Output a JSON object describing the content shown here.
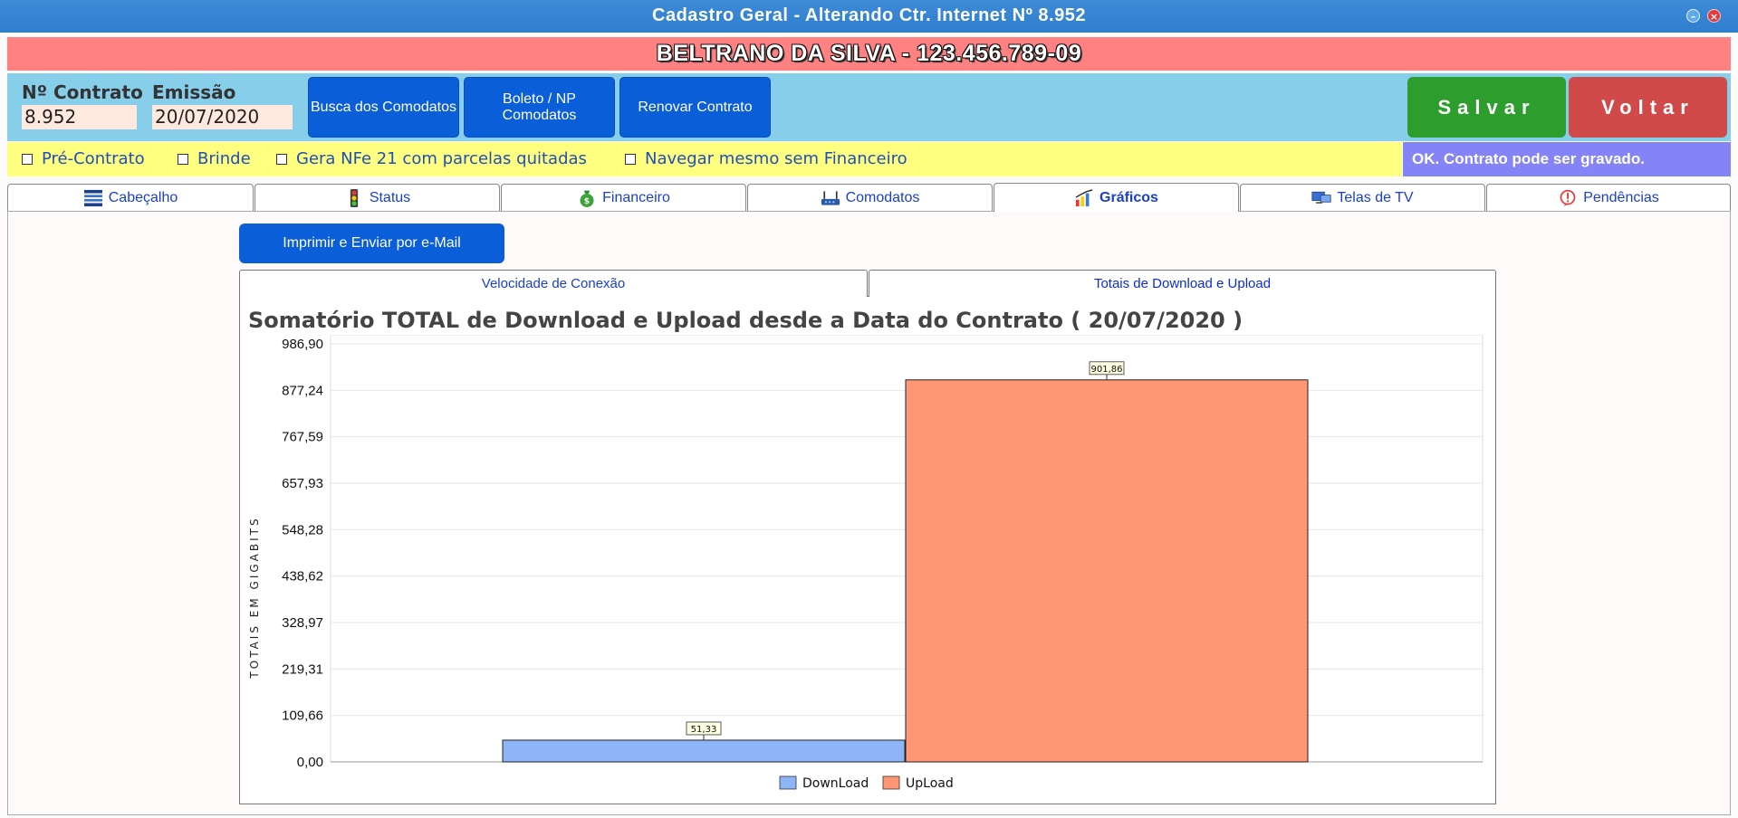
{
  "window": {
    "title": "Cadastro Geral - Alterando Ctr. Internet Nº 8.952"
  },
  "client": {
    "name_line": "BELTRANO DA SILVA - 123.456.789-09"
  },
  "contract": {
    "number_label": "Nº Contrato",
    "number_value": "8.952",
    "issue_label": "Emissão",
    "issue_value": "20/07/2020",
    "buttons": {
      "busca": "Busca dos Comodatos",
      "boleto": "Boleto / NP Comodatos",
      "renovar": "Renovar Contrato",
      "salvar": "Salvar",
      "voltar": "Voltar"
    }
  },
  "options": {
    "pre_contrato": "Pré-Contrato",
    "brinde": "Brinde",
    "gera_nfe": "Gera NFe 21 com parcelas quitadas",
    "navegar": "Navegar mesmo sem Financeiro",
    "status_message": "OK. Contrato pode ser gravado."
  },
  "tabs": [
    {
      "label": "Cabeçalho",
      "icon": "list-icon"
    },
    {
      "label": "Status",
      "icon": "traffic-light-icon"
    },
    {
      "label": "Financeiro",
      "icon": "money-bag-icon"
    },
    {
      "label": "Comodatos",
      "icon": "router-icon"
    },
    {
      "label": "Gráficos",
      "icon": "chart-icon",
      "active": true
    },
    {
      "label": "Telas de TV",
      "icon": "tv-icon"
    },
    {
      "label": "Pendências",
      "icon": "alert-icon"
    }
  ],
  "graficos": {
    "print_button": "Imprimir e Enviar por e-Mail",
    "subtabs": [
      "Velocidade de Conexão",
      "Totais de Download e Upload"
    ]
  },
  "colors": {
    "download": "#8db4f7",
    "upload": "#ff9775",
    "salvar": "#2d9e2d",
    "voltar": "#d04a4a"
  },
  "chart_data": {
    "type": "bar",
    "title": "Somatório TOTAL de Download e Upload desde a Data do Contrato ( 20/07/2020 )",
    "ylabel": "TOTAIS EM GIGABITS",
    "xlabel": "",
    "ylim": [
      0,
      986.9
    ],
    "yticks": [
      "0,00",
      "109,66",
      "219,31",
      "328,97",
      "438,62",
      "548,28",
      "657,93",
      "767,59",
      "877,24",
      "986,90"
    ],
    "series": [
      {
        "name": "DownLoad",
        "values": [
          51.33
        ],
        "label": "51,33"
      },
      {
        "name": "UpLoad",
        "values": [
          901.86
        ],
        "label": "901,86"
      }
    ],
    "legend": "bottom"
  }
}
